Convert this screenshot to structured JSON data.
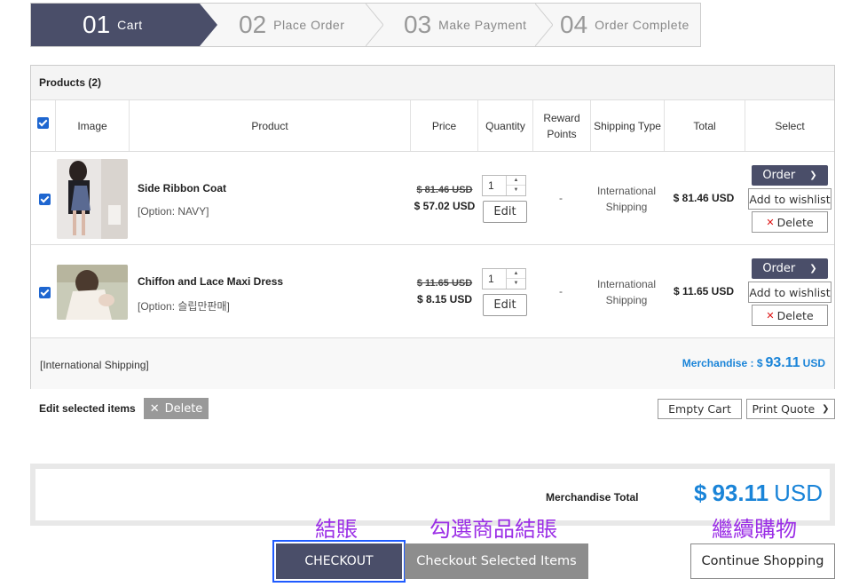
{
  "steps": [
    {
      "num": "01",
      "label": "Cart"
    },
    {
      "num": "02",
      "label": "Place Order"
    },
    {
      "num": "03",
      "label": "Make Payment"
    },
    {
      "num": "04",
      "label": "Order Complete"
    }
  ],
  "cart": {
    "heading": "Products (2)",
    "columns": {
      "image": "Image",
      "product": "Product",
      "price": "Price",
      "quantity": "Quantity",
      "reward": "Reward Points",
      "shipping": "Shipping Type",
      "total": "Total",
      "select": "Select"
    },
    "items": [
      {
        "name": "Side Ribbon Coat",
        "option": "[Option: NAVY]",
        "price_old": "$ 81.46 USD",
        "price_new": "$ 57.02 USD",
        "quantity": "1",
        "edit": "Edit",
        "reward": "-",
        "shipping": "International Shipping",
        "total": "$ 81.46 USD",
        "order": "Order",
        "wishlist": "Add to wishlist",
        "delete": "Delete"
      },
      {
        "name": "Chiffon and Lace Maxi Dress",
        "option": "[Option: 슬립만판매]",
        "price_old": "$ 11.65 USD",
        "price_new": "$ 8.15 USD",
        "quantity": "1",
        "edit": "Edit",
        "reward": "-",
        "shipping": "International Shipping",
        "total": "$ 11.65 USD",
        "order": "Order",
        "wishlist": "Add to wishlist",
        "delete": "Delete"
      }
    ],
    "footer": {
      "shipping_label": "[International Shipping]",
      "merch_label": "Merchandise : $",
      "merch_amount": "93.11",
      "merch_currency": "USD"
    }
  },
  "actions": {
    "edit_selected": "Edit selected items",
    "delete_selected": "Delete",
    "empty_cart": "Empty Cart",
    "print_quote": "Print Quote"
  },
  "summary": {
    "label": "Merchandise Total",
    "symbol": "$",
    "amount": "93.11",
    "currency": "USD"
  },
  "annotations": {
    "checkout": "結賬",
    "checkout_selected": "勾選商品結賬",
    "continue": "繼續購物"
  },
  "buttons": {
    "checkout": "CHECKOUT",
    "checkout_selected": "Checkout Selected Items",
    "continue": "Continue Shopping"
  },
  "colors": {
    "accent": "#4a4e69",
    "price_blue": "#1a84d8",
    "annotation": "#9b2ee6"
  }
}
